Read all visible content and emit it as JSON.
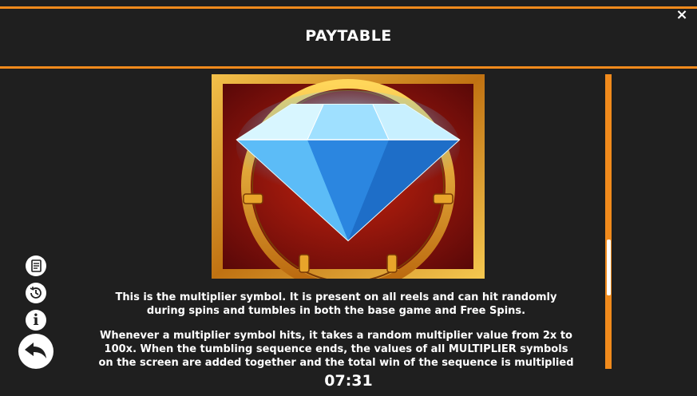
{
  "header": {
    "title": "PAYTABLE"
  },
  "close_button": {
    "icon": "close-icon",
    "label": "×"
  },
  "symbol": {
    "name": "multiplier-symbol",
    "image": "diamond-icon"
  },
  "description": [
    {
      "lines": [
        "This is the multiplier symbol. It is present on all reels and can hit randomly",
        "during spins and tumbles in both the base game and Free Spins."
      ]
    },
    {
      "lines": [
        "Whenever a multiplier symbol hits, it takes a random multiplier value from 2x to",
        "100x. When the tumbling sequence ends, the values of all MULTIPLIER symbols",
        "on the screen are added together and the total win of the sequence is multiplied"
      ]
    }
  ],
  "sidebar": {
    "icons": [
      "rules-icon",
      "history-icon",
      "info-icon",
      "back-arrow-icon"
    ],
    "info_label": "i"
  },
  "clock": "07:31",
  "colors": {
    "accent": "#f08a1c",
    "background": "#1f1f1f",
    "text": "#ffffff"
  }
}
